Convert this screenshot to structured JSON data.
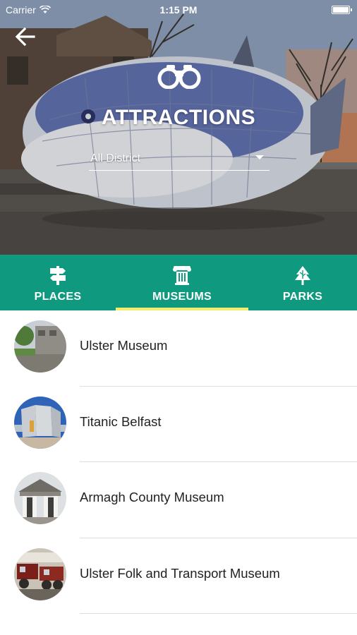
{
  "status_bar": {
    "carrier": "Carrier",
    "time": "1:15 PM"
  },
  "header": {
    "back_icon": "arrow-left-icon",
    "category_icon": "binoculars-icon",
    "title": "ATTRACTIONS",
    "district_select": {
      "value": "All District"
    }
  },
  "tabs": [
    {
      "label": "PLACES",
      "icon": "signpost-icon",
      "active": false
    },
    {
      "label": "MUSEUMS",
      "icon": "column-icon",
      "active": true
    },
    {
      "label": "PARKS",
      "icon": "trees-icon",
      "active": false
    }
  ],
  "museums": [
    {
      "name": "Ulster Museum"
    },
    {
      "name": "Titanic Belfast"
    },
    {
      "name": "Armagh County Museum"
    },
    {
      "name": "Ulster Folk and Transport Museum"
    }
  ],
  "colors": {
    "tab_bar": "#0f9a7f",
    "active_tab_indicator": "#f3ec6e",
    "list_text": "#222222",
    "divider": "#dedede"
  }
}
